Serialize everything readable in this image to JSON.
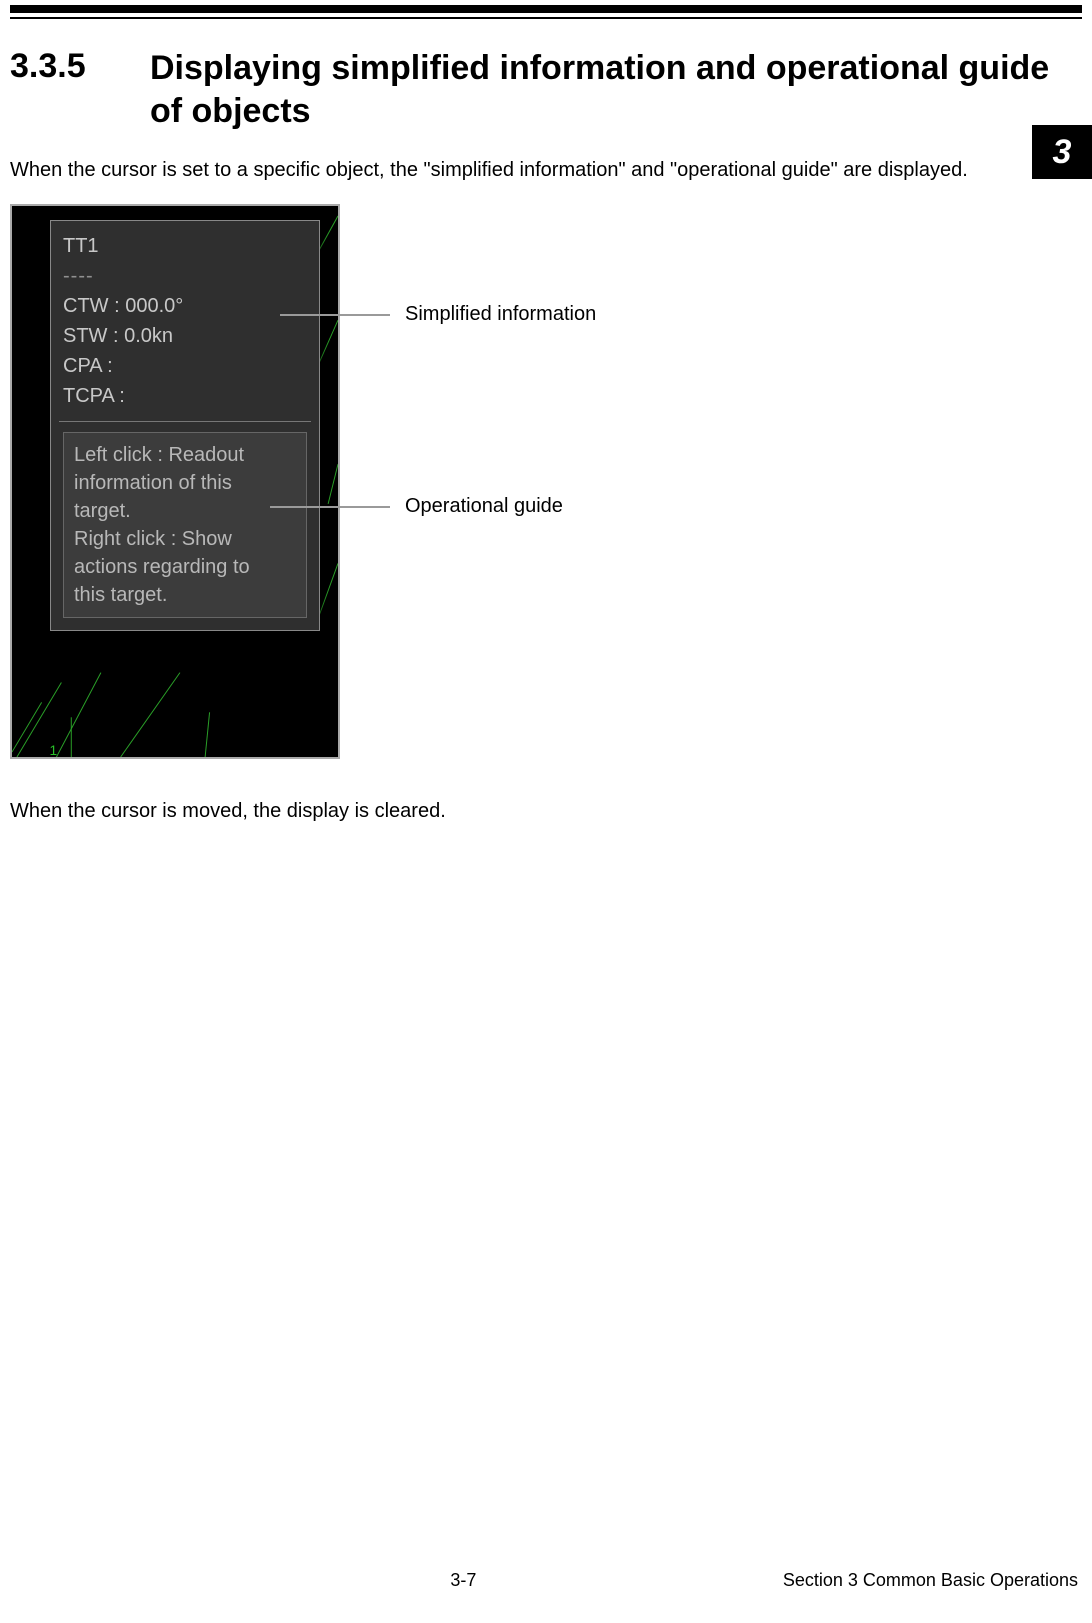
{
  "chapter_tab": "3",
  "heading": {
    "number": "3.3.5",
    "title": "Displaying simplified information and operational guide of objects"
  },
  "intro_paragraph": "When the cursor is set to a specific object, the \"simplified information\" and \"operational guide\" are displayed.",
  "closing_paragraph": "When the cursor is moved, the display is cleared.",
  "tooltip": {
    "title": "TT1",
    "dashes": "----",
    "rows": {
      "ctw": "CTW : 000.0°",
      "stw": "STW : 0.0kn",
      "cpa": "CPA :",
      "tcpa": "TCPA :"
    },
    "guide": {
      "line1": "Left click : Readout",
      "line2": "information of this",
      "line3": "target.",
      "line4": "Right click : Show",
      "line5": "actions regarding to",
      "line6": "this target."
    }
  },
  "callouts": {
    "simplified": "Simplified information",
    "operational": "Operational guide"
  },
  "footer": {
    "page": "3-7",
    "section": "Section 3    Common Basic Operations"
  }
}
